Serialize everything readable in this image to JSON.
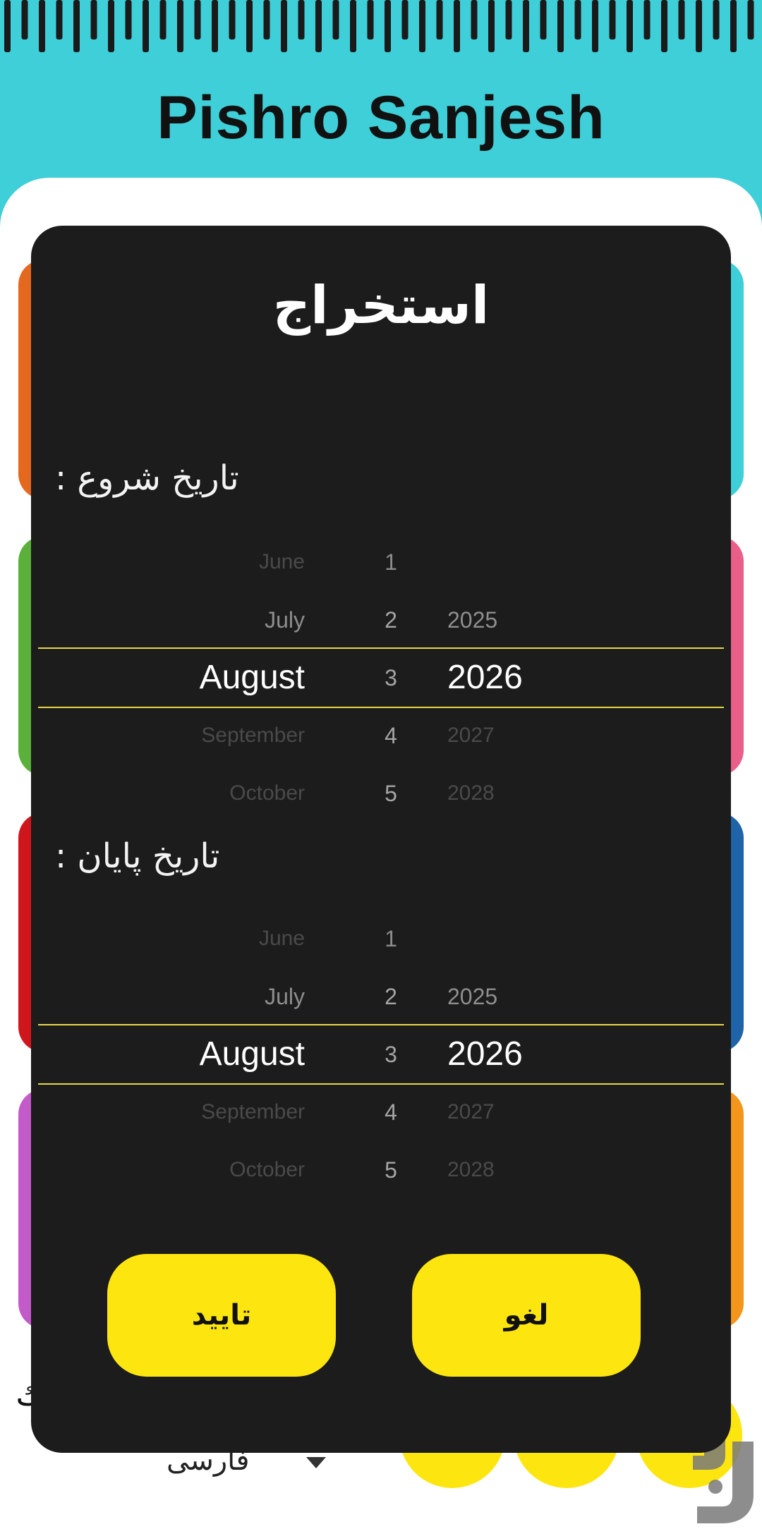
{
  "app": {
    "title": "Pishro Sanjesh",
    "colors": {
      "header": "#3ecfd8",
      "dialog_bg": "#1c1c1c",
      "accent_yellow": "#fde610",
      "selection_line": "#e5d84a",
      "card_orange": "#e5681f",
      "card_cyan": "#3ecfd8",
      "card_green": "#5ab03a",
      "card_pink": "#ea5f8a",
      "card_red": "#d0161d",
      "card_blue": "#1f64a8",
      "card_purple": "#c35ac9",
      "card_amber": "#f3961b"
    }
  },
  "background": {
    "language_label": "فارسی",
    "side_text": "ك"
  },
  "dialog": {
    "title": "استخراج",
    "start_label": "تاریخ شروع :",
    "end_label": "تاریخ پایان :",
    "start_picker": {
      "months": [
        "June",
        "July",
        "August",
        "September",
        "October"
      ],
      "days": [
        "1",
        "2",
        "3",
        "4",
        "5"
      ],
      "years": [
        "",
        "2025",
        "2026",
        "2027",
        "2028"
      ],
      "selected": {
        "month": "August",
        "day": "3",
        "year": "2026"
      }
    },
    "end_picker": {
      "months": [
        "June",
        "July",
        "August",
        "September",
        "October"
      ],
      "days": [
        "1",
        "2",
        "3",
        "4",
        "5"
      ],
      "years": [
        "",
        "2025",
        "2026",
        "2027",
        "2028"
      ],
      "selected": {
        "month": "August",
        "day": "3",
        "year": "2026"
      }
    },
    "confirm_label": "تایید",
    "cancel_label": "لغو"
  }
}
